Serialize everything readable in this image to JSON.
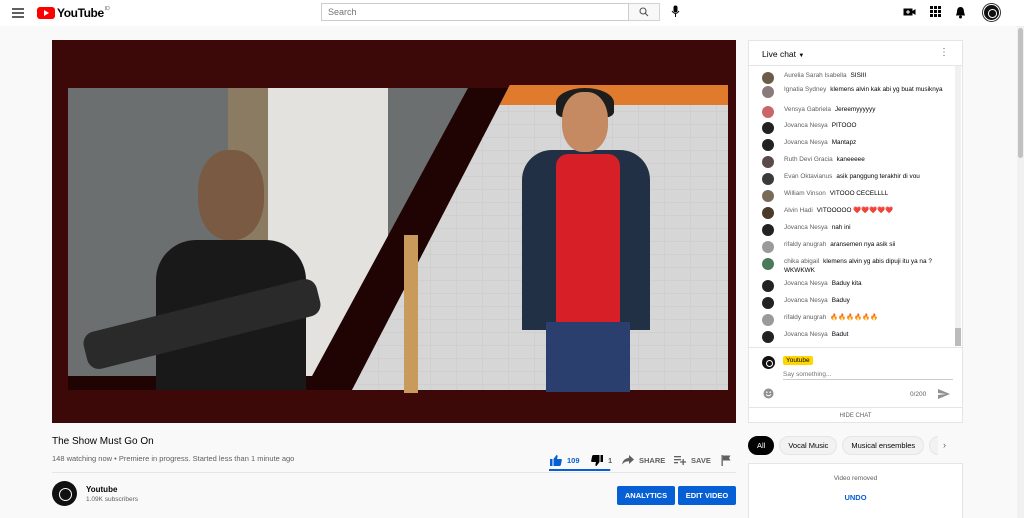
{
  "header": {
    "logo_text": "YouTube",
    "logo_country": "ID",
    "search_placeholder": "Search"
  },
  "video": {
    "title": "The Show Must Go On",
    "meta": "148 watching now • Premiere in progress. Started less than 1 minute ago",
    "likes": "109",
    "dislikes": "1",
    "like_ratio": 0.99,
    "share_label": "SHARE",
    "save_label": "SAVE"
  },
  "channel": {
    "name": "Youtube",
    "subscribers": "1.09K subscribers",
    "analytics_label": "ANALYTICS",
    "edit_label": "EDIT VIDEO"
  },
  "chat": {
    "header_label": "Live chat",
    "messages": [
      {
        "author": "Aurelia Sarah Isabella",
        "text": "SISIII"
      },
      {
        "author": "Ignatia Sydney",
        "text": "klemens alvin kak abi yg buat musiknya"
      },
      {
        "author": "Vensya Gabriela",
        "text": "Jereemyyyyyy"
      },
      {
        "author": "Jovanca Nesya",
        "text": "PITOOO"
      },
      {
        "author": "Jovanca Nesya",
        "text": "Mantapz"
      },
      {
        "author": "Ruth Devi Gracia",
        "text": "kaneeeee"
      },
      {
        "author": "Evan Oktavianus",
        "text": "asik panggung terakhir di vou"
      },
      {
        "author": "William Vinson",
        "text": "VITOOO CECELLLL"
      },
      {
        "author": "Alvin Hadi",
        "text": "VITOOOOO ❤️❤️❤️❤️❤️"
      },
      {
        "author": "Jovanca Nesya",
        "text": "nah ini"
      },
      {
        "author": "rifaldy anugrah",
        "text": "aransemen nya asik sii"
      },
      {
        "author": "chika abigail",
        "text": "klemens alvin yg abis dipuji itu ya na ? WKWKWK"
      },
      {
        "author": "Jovanca Nesya",
        "text": "Baduy kita"
      },
      {
        "author": "Jovanca Nesya",
        "text": "Baduy"
      },
      {
        "author": "rifaldy anugrah",
        "text": "🔥🔥🔥🔥🔥🔥"
      },
      {
        "author": "Jovanca Nesya",
        "text": "Badut"
      }
    ],
    "input_name": "Youtube",
    "input_placeholder": "Say something...",
    "counter": "0/200",
    "hide_label": "HIDE CHAT"
  },
  "chips": [
    "All",
    "Vocal Music",
    "Musical ensembles",
    "Fi"
  ],
  "removed": {
    "text": "Video removed",
    "undo_label": "UNDO"
  },
  "colors": {
    "accent_blue": "#065fd4",
    "brand_red": "#ff0000",
    "video_background": "#3d0808"
  }
}
